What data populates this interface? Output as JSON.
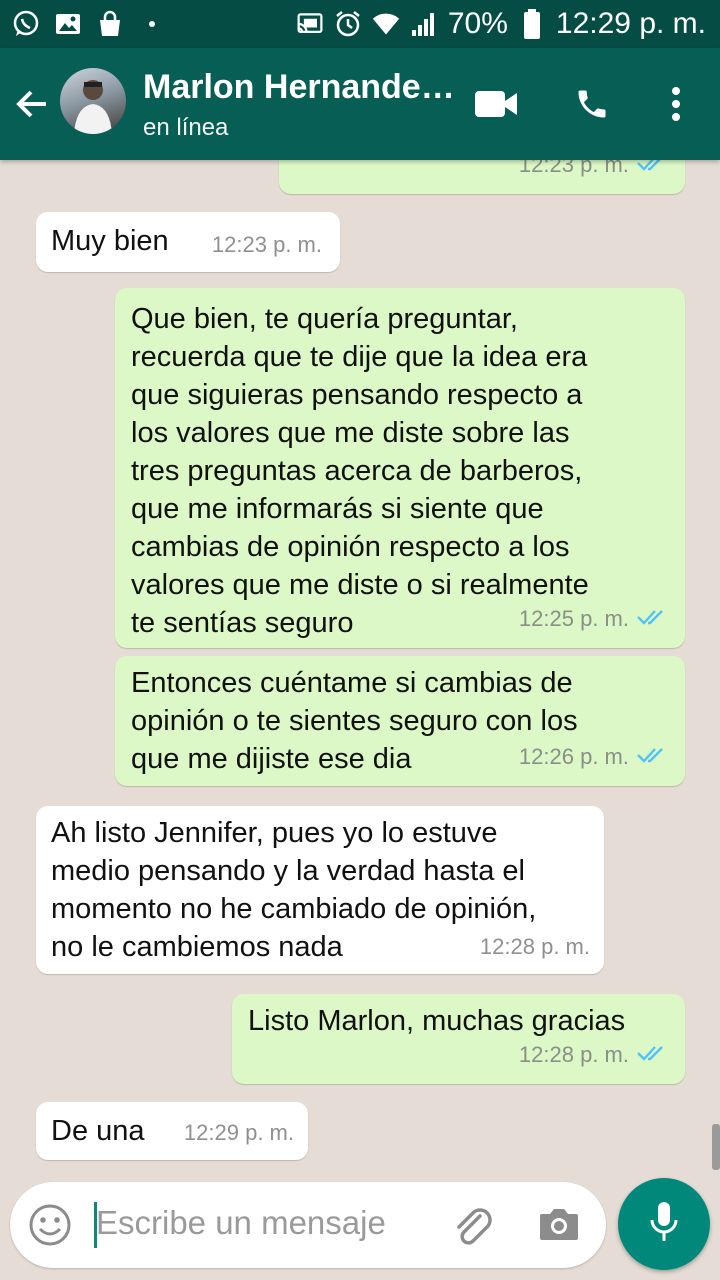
{
  "status_bar": {
    "battery": "70%",
    "time": "12:29 p. m.",
    "icons": [
      "whatsapp-icon",
      "gallery-icon",
      "shop-bag-icon",
      "dot-icon",
      "cast-icon",
      "alarm-icon",
      "wifi-icon",
      "signal-icon",
      "battery-icon"
    ]
  },
  "header": {
    "contact_name": "Marlon Hernande…",
    "status": "en línea",
    "icons": [
      "back-arrow-icon",
      "video-call-icon",
      "phone-icon",
      "more-vert-icon"
    ]
  },
  "messages": [
    {
      "direction": "out",
      "text": "",
      "time": "12:23 p. m.",
      "read": true
    },
    {
      "direction": "in",
      "text": "Muy bien",
      "time": "12:23 p. m."
    },
    {
      "direction": "out",
      "lines": [
        "Que bien, te quería preguntar,",
        "recuerda que te dije que la idea era",
        "que siguieras pensando respecto a",
        "los valores que me diste sobre las",
        "tres preguntas acerca de barberos,",
        "que me informarás si siente que",
        "cambias de opinión respecto a los",
        "valores que me diste o si realmente",
        "te sentías seguro"
      ],
      "time": "12:25 p. m.",
      "read": true
    },
    {
      "direction": "out",
      "lines": [
        "Entonces cuéntame si cambias de",
        "opinión o te sientes seguro con los",
        "que me dijiste ese dia"
      ],
      "time": "12:26 p. m.",
      "read": true
    },
    {
      "direction": "in",
      "lines": [
        "Ah listo Jennifer, pues yo lo estuve",
        "medio pensando y la verdad hasta el",
        "momento no he cambiado de opinión,",
        "no le cambiemos nada"
      ],
      "time": "12:28 p. m."
    },
    {
      "direction": "out",
      "text": "Listo Marlon, muchas gracias",
      "time": "12:28 p. m.",
      "read": true
    },
    {
      "direction": "in",
      "text": "De una",
      "time": "12:29 p. m."
    }
  ],
  "input": {
    "placeholder": "Escribe un mensaje",
    "icons": [
      "emoji-icon",
      "attach-icon",
      "camera-icon",
      "mic-icon"
    ]
  },
  "colors": {
    "status_bar": "#054d44",
    "app_bar": "#075e54",
    "outgoing_bubble": "#dcf8c6",
    "incoming_bubble": "#ffffff",
    "read_ticks": "#4fc3f7",
    "mic_button": "#00897b",
    "chat_background": "#e5ddd5"
  }
}
